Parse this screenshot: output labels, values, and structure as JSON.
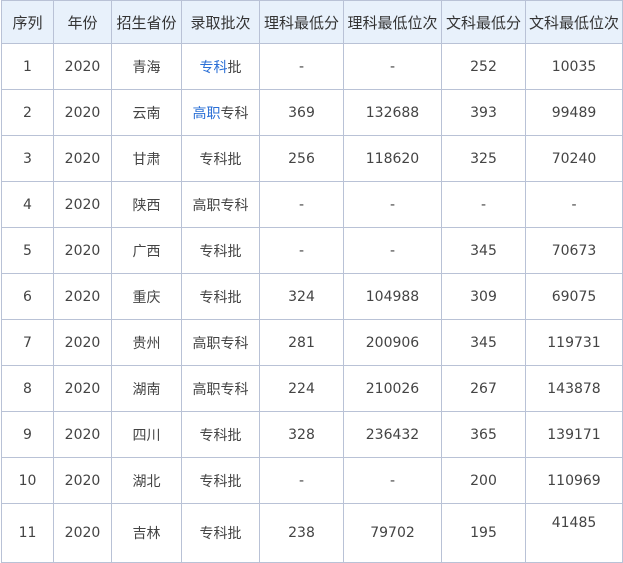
{
  "headers": [
    "序列",
    "年份",
    "招生省份",
    "录取批次",
    "理科最低分",
    "理科最低位次",
    "文科最低分",
    "文科最低位次"
  ],
  "rows": [
    {
      "seq": "1",
      "year": "2020",
      "province": "青海",
      "batch": "专科批",
      "sci_score": "-",
      "sci_rank": "-",
      "arts_score": "252",
      "arts_rank": "10035"
    },
    {
      "seq": "2",
      "year": "2020",
      "province": "云南",
      "batch": "高职专科",
      "sci_score": "369",
      "sci_rank": "132688",
      "arts_score": "393",
      "arts_rank": "99489"
    },
    {
      "seq": "3",
      "year": "2020",
      "province": "甘肃",
      "batch": "专科批",
      "sci_score": "256",
      "sci_rank": "118620",
      "arts_score": "325",
      "arts_rank": "70240"
    },
    {
      "seq": "4",
      "year": "2020",
      "province": "陕西",
      "batch": "高职专科",
      "sci_score": "-",
      "sci_rank": "-",
      "arts_score": "-",
      "arts_rank": "-"
    },
    {
      "seq": "5",
      "year": "2020",
      "province": "广西",
      "batch": "专科批",
      "sci_score": "-",
      "sci_rank": "-",
      "arts_score": "345",
      "arts_rank": "70673"
    },
    {
      "seq": "6",
      "year": "2020",
      "province": "重庆",
      "batch": "专科批",
      "sci_score": "324",
      "sci_rank": "104988",
      "arts_score": "309",
      "arts_rank": "69075"
    },
    {
      "seq": "7",
      "year": "2020",
      "province": "贵州",
      "batch": "高职专科",
      "sci_score": "281",
      "sci_rank": "200906",
      "arts_score": "345",
      "arts_rank": "119731"
    },
    {
      "seq": "8",
      "year": "2020",
      "province": "湖南",
      "batch": "高职专科",
      "sci_score": "224",
      "sci_rank": "210026",
      "arts_score": "267",
      "arts_rank": "143878"
    },
    {
      "seq": "9",
      "year": "2020",
      "province": "四川",
      "batch": "专科批",
      "sci_score": "328",
      "sci_rank": "236432",
      "arts_score": "365",
      "arts_rank": "139171"
    },
    {
      "seq": "10",
      "year": "2020",
      "province": "湖北",
      "batch": "专科批",
      "sci_score": "-",
      "sci_rank": "-",
      "arts_score": "200",
      "arts_rank": "110969"
    },
    {
      "seq": "11",
      "year": "2020",
      "province": "吉林",
      "batch": "专科批",
      "sci_score": "238",
      "sci_rank": "79702",
      "arts_score": "195",
      "arts_rank": "41485"
    }
  ],
  "links": {
    "row1_batch_link": "专科",
    "row1_batch_rest": "批",
    "row2_batch_link": "高职",
    "row2_batch_rest": "专科"
  },
  "colors": {
    "header_bg": "#e8f1fb",
    "border": "#b9c2d6",
    "link": "#2a6fd6",
    "text": "#444444"
  }
}
